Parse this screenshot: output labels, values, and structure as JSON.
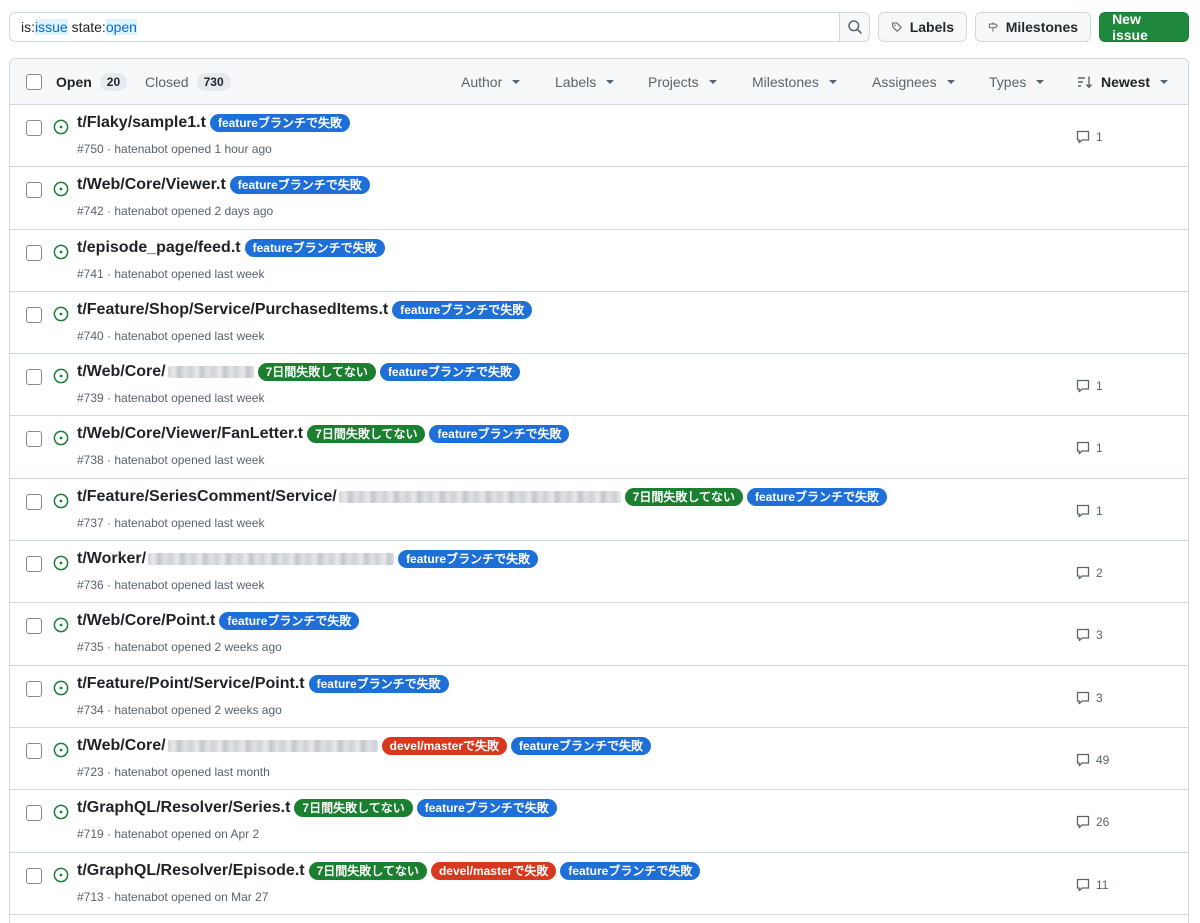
{
  "search": {
    "tokens": [
      {
        "key": "is:",
        "value": "issue"
      },
      {
        "key": "state:",
        "value": "open"
      }
    ]
  },
  "toolbar": {
    "labels_label": "Labels",
    "milestones_label": "Milestones",
    "new_issue_label": "New issue"
  },
  "header": {
    "open_label": "Open",
    "open_count": "20",
    "closed_label": "Closed",
    "closed_count": "730",
    "filters": [
      "Author",
      "Labels",
      "Projects",
      "Milestones",
      "Assignees",
      "Types"
    ],
    "sort_label": "Newest"
  },
  "colors": {
    "feature": "#1f6fd9",
    "seven_days": "#1a7f2e",
    "devel": "#d8381e",
    "open_icon": "#1a7f37",
    "primary_button": "#1f883d"
  },
  "issues": [
    {
      "title": "t/Flaky/sample1.t",
      "redacted": 0,
      "labels": [
        {
          "text": "featureブランチで失敗",
          "kind": "feature"
        }
      ],
      "meta": "#750 · hatenabot opened 1 hour ago",
      "comments": "1"
    },
    {
      "title": "t/Web/Core/Viewer.t",
      "redacted": 0,
      "labels": [
        {
          "text": "featureブランチで失敗",
          "kind": "feature"
        }
      ],
      "meta": "#742 · hatenabot opened 2 days ago",
      "comments": ""
    },
    {
      "title": "t/episode_page/feed.t",
      "redacted": 0,
      "labels": [
        {
          "text": "featureブランチで失敗",
          "kind": "feature"
        }
      ],
      "meta": "#741 · hatenabot opened last week",
      "comments": ""
    },
    {
      "title": "t/Feature/Shop/Service/PurchasedItems.t",
      "redacted": 0,
      "labels": [
        {
          "text": "featureブランチで失敗",
          "kind": "feature"
        }
      ],
      "meta": "#740 · hatenabot opened last week",
      "comments": ""
    },
    {
      "title": "t/Web/Core/",
      "redacted": 1,
      "labels": [
        {
          "text": "7日間失敗してない",
          "kind": "seven_days"
        },
        {
          "text": "featureブランチで失敗",
          "kind": "feature"
        }
      ],
      "meta": "#739 · hatenabot opened last week",
      "comments": "1"
    },
    {
      "title": "t/Web/Core/Viewer/FanLetter.t",
      "redacted": 0,
      "labels": [
        {
          "text": "7日間失敗してない",
          "kind": "seven_days"
        },
        {
          "text": "featureブランチで失敗",
          "kind": "feature"
        }
      ],
      "meta": "#738 · hatenabot opened last week",
      "comments": "1"
    },
    {
      "title": "t/Feature/SeriesComment/Service/",
      "redacted": 3,
      "labels": [
        {
          "text": "7日間失敗してない",
          "kind": "seven_days"
        },
        {
          "text": "featureブランチで失敗",
          "kind": "feature"
        }
      ],
      "meta": "#737 · hatenabot opened last week",
      "comments": "1"
    },
    {
      "title": "t/Worker/",
      "redacted": 2,
      "labels": [
        {
          "text": "featureブランチで失敗",
          "kind": "feature"
        }
      ],
      "meta": "#736 · hatenabot opened last week",
      "comments": "2"
    },
    {
      "title": "t/Web/Core/Point.t",
      "redacted": 0,
      "labels": [
        {
          "text": "featureブランチで失敗",
          "kind": "feature"
        }
      ],
      "meta": "#735 · hatenabot opened 2 weeks ago",
      "comments": "3"
    },
    {
      "title": "t/Feature/Point/Service/Point.t",
      "redacted": 0,
      "labels": [
        {
          "text": "featureブランチで失敗",
          "kind": "feature"
        }
      ],
      "meta": "#734 · hatenabot opened 2 weeks ago",
      "comments": "3"
    },
    {
      "title": "t/Web/Core/",
      "redacted": 4,
      "labels": [
        {
          "text": "devel/masterで失敗",
          "kind": "devel"
        },
        {
          "text": "featureブランチで失敗",
          "kind": "feature"
        }
      ],
      "meta": "#723 · hatenabot opened last month",
      "comments": "49"
    },
    {
      "title": "t/GraphQL/Resolver/Series.t",
      "redacted": 0,
      "labels": [
        {
          "text": "7日間失敗してない",
          "kind": "seven_days"
        },
        {
          "text": "featureブランチで失敗",
          "kind": "feature"
        }
      ],
      "meta": "#719 · hatenabot opened on Apr 2",
      "comments": "26"
    },
    {
      "title": "t/GraphQL/Resolver/Episode.t",
      "redacted": 0,
      "labels": [
        {
          "text": "7日間失敗してない",
          "kind": "seven_days"
        },
        {
          "text": "devel/masterで失敗",
          "kind": "devel"
        },
        {
          "text": "featureブランチで失敗",
          "kind": "feature"
        }
      ],
      "meta": "#713 · hatenabot opened on Mar 27",
      "comments": "11"
    }
  ]
}
